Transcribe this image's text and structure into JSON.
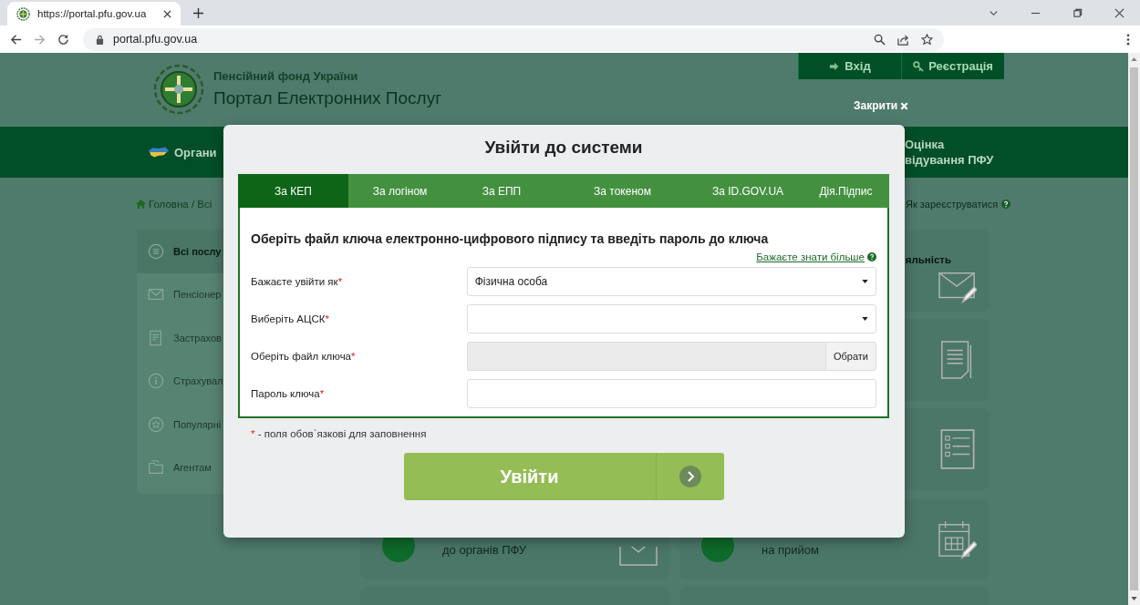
{
  "browser": {
    "tab_title": "https://portal.pfu.gov.ua",
    "url": "portal.pfu.gov.ua"
  },
  "site": {
    "org_name": "Пенсійний фонд України",
    "portal_title": "Портал Електронних Послуг",
    "header_buttons": [
      {
        "label": "Вхід",
        "kind": "login"
      },
      {
        "label": "Реєстрація",
        "kind": "register"
      }
    ],
    "nav_left": "Органи",
    "nav_right": [
      "Оцінка",
      "відування ПФУ"
    ],
    "breadcrumb": "Головна / Всі",
    "register_help": "Як зареєструватися",
    "sidebar": [
      {
        "label": "Всі послу",
        "selected": true
      },
      {
        "label": "Пенсіонер",
        "selected": false
      },
      {
        "label": "Застрахов",
        "selected": false
      },
      {
        "label": "Страхувал",
        "selected": false
      },
      {
        "label": "Популярні",
        "selected": false
      },
      {
        "label": "Агентам",
        "selected": false
      }
    ],
    "right_card_text": "яльність",
    "bottom_cards": [
      "до органів ПФУ",
      "на прийом"
    ]
  },
  "close_label": "Закрити",
  "modal": {
    "title": "Увійти до системи",
    "tabs": [
      {
        "label": "За КЕП",
        "selected": true
      },
      {
        "label": "За логіном",
        "selected": false
      },
      {
        "label": "За ЕПП",
        "selected": false
      },
      {
        "label": "За токеном",
        "selected": false
      },
      {
        "label": "За ID.GOV.UA",
        "selected": false
      },
      {
        "label": "Дія.Підпис",
        "selected": false
      }
    ],
    "heading": "Оберіть файл ключа електронно-цифрового підпису та введіть пароль до ключа",
    "more_link": "Бажаєте знати більше",
    "required_mark": "*",
    "fields": [
      {
        "label": "Бажаєте увійти як",
        "required": true,
        "kind": "select",
        "value": "Фізична особа"
      },
      {
        "label": "Виберіть АЦСК",
        "required": true,
        "kind": "select"
      },
      {
        "label": "Оберіть файл ключа",
        "required": true,
        "kind": "file",
        "button": "Обрати"
      },
      {
        "label": "Пароль ключа",
        "required": true,
        "kind": "password"
      }
    ],
    "required_note": "- поля обов`язкові для заповнення",
    "submit": "Увійти"
  }
}
